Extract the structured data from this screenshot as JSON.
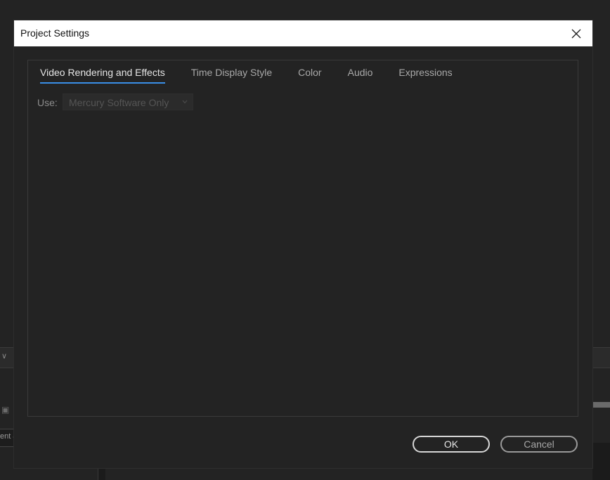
{
  "background": {
    "truncated_label": "ent &"
  },
  "dialog": {
    "title": "Project Settings",
    "close_icon": "close-icon",
    "tabs": [
      {
        "label": "Video Rendering and Effects",
        "active": true
      },
      {
        "label": "Time Display Style",
        "active": false
      },
      {
        "label": "Color",
        "active": false
      },
      {
        "label": "Audio",
        "active": false
      },
      {
        "label": "Expressions",
        "active": false
      }
    ],
    "use_label": "Use:",
    "use_select": {
      "value": "Mercury Software Only",
      "disabled": true
    },
    "ok_label": "OK",
    "cancel_label": "Cancel"
  },
  "colors": {
    "accent": "#3a8ee6",
    "dialog_bg": "#232323",
    "titlebar_bg": "#ffffff"
  }
}
